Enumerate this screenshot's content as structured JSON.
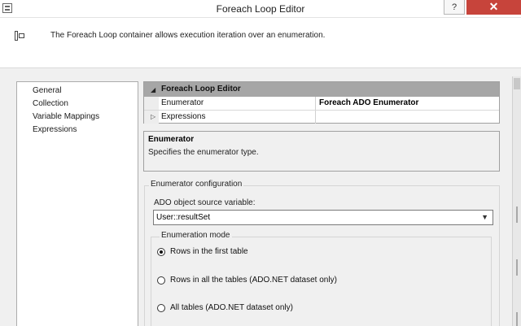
{
  "window": {
    "title": "Foreach Loop Editor",
    "help_label": "?",
    "close_label": "✕"
  },
  "header": {
    "icon": "foreach-loop-container-icon",
    "description": "The Foreach Loop container allows execution iteration over an enumeration."
  },
  "nav": {
    "items": [
      {
        "label": "General"
      },
      {
        "label": "Collection"
      },
      {
        "label": "Variable Mappings"
      },
      {
        "label": "Expressions"
      }
    ]
  },
  "property_grid": {
    "category": "Foreach Loop Editor",
    "rows": [
      {
        "name": "Enumerator",
        "value": "Foreach ADO Enumerator"
      },
      {
        "name": "Expressions",
        "value": ""
      }
    ]
  },
  "description_panel": {
    "title": "Enumerator",
    "text": "Specifies the enumerator type."
  },
  "enumerator_config": {
    "group_label": "Enumerator configuration",
    "source_label": "ADO object source variable:",
    "source_value": "User::resultSet",
    "mode_label": "Enumeration mode",
    "options": [
      {
        "label": "Rows in the first table",
        "selected": true
      },
      {
        "label": "Rows in all the tables (ADO.NET dataset only)",
        "selected": false
      },
      {
        "label": "All tables (ADO.NET dataset only)",
        "selected": false
      }
    ]
  }
}
